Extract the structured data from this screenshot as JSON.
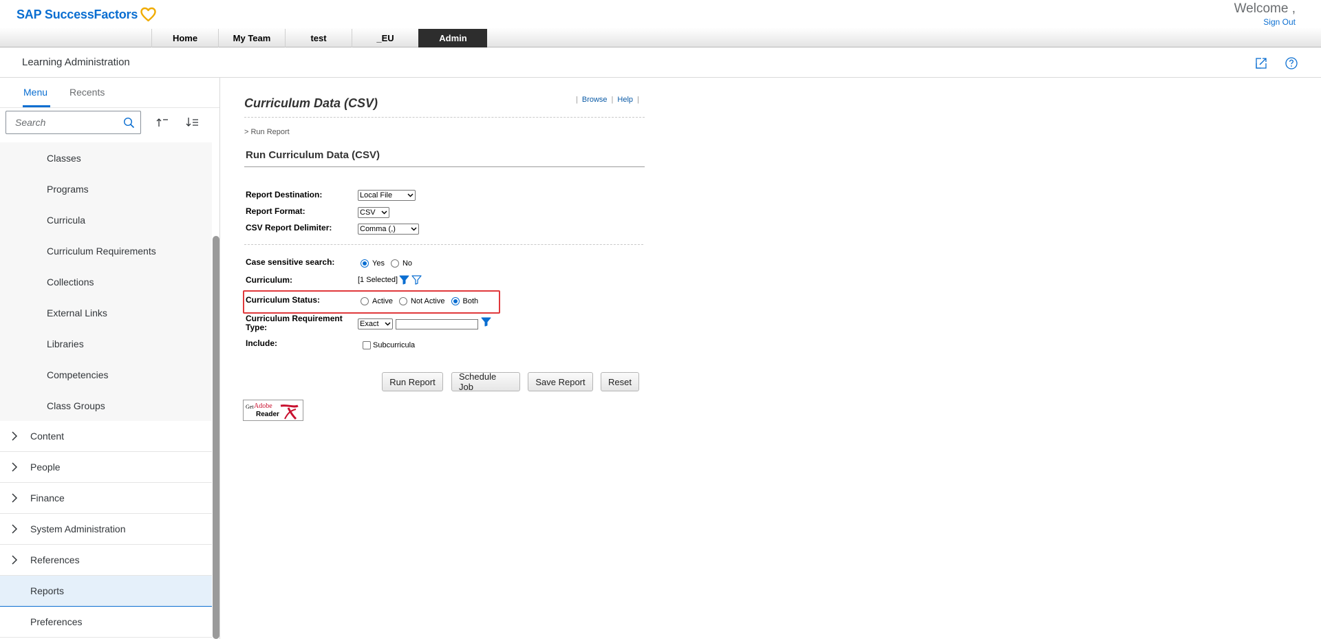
{
  "header": {
    "brand": "SAP SuccessFactors",
    "welcome": "Welcome ,",
    "sign_out": "Sign Out",
    "nav_tabs": [
      "Home",
      "My Team",
      "test",
      "_EU",
      "Admin"
    ],
    "active_tab": "Admin"
  },
  "app": {
    "title": "Learning Administration"
  },
  "sidebar": {
    "tabs": [
      "Menu",
      "Recents"
    ],
    "active_tab": "Menu",
    "search_placeholder": "Search",
    "sub_items": [
      "Classes",
      "Programs",
      "Curricula",
      "Curriculum Requirements",
      "Collections",
      "External Links",
      "Libraries",
      "Competencies",
      "Class Groups"
    ],
    "sections": [
      "Content",
      "People",
      "Finance",
      "System Administration",
      "References"
    ],
    "reports": "Reports",
    "preferences": "Preferences"
  },
  "report": {
    "title": "Curriculum Data (CSV)",
    "links": [
      "Browse",
      "Help"
    ],
    "breadcrumb": "> Run Report",
    "section_title": "Run Curriculum Data (CSV)",
    "fields": {
      "destination_label": "Report Destination:",
      "destination_value": "Local File",
      "format_label": "Report Format:",
      "format_value": "CSV",
      "delimiter_label": "CSV Report Delimiter:",
      "delimiter_value": "Comma (,)",
      "case_label": "Case sensitive search:",
      "case_options": [
        "Yes",
        "No"
      ],
      "case_selected": "Yes",
      "curriculum_label": "Curriculum:",
      "curriculum_value": "[1 Selected]",
      "status_label": "Curriculum Status:",
      "status_options": [
        "Active",
        "Not Active",
        "Both"
      ],
      "status_selected": "Both",
      "req_type_label_1": "Curriculum Requirement",
      "req_type_label_2": "Type:",
      "req_type_value": "Exact",
      "include_label": "Include:",
      "include_option": "Subcurricula"
    },
    "buttons": [
      "Run Report",
      "Schedule Job",
      "Save Report",
      "Reset"
    ],
    "adobe": {
      "get": "Get",
      "brand": "Adobe",
      "product": "Reader"
    }
  },
  "colors": {
    "accent": "#0a6ed1",
    "highlight_border": "#e0383b",
    "active_tab_bg": "#2d2d2d",
    "selected_item_bg": "#e5f0fa"
  }
}
